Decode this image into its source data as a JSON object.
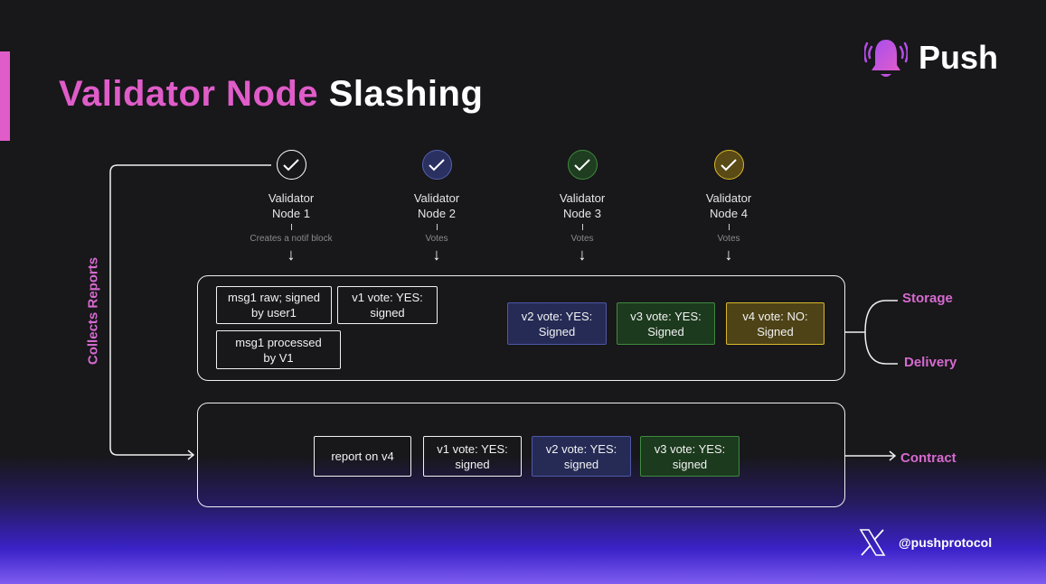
{
  "title": {
    "highlight": "Validator Node",
    "rest": "Slashing"
  },
  "brand": {
    "name": "Push",
    "icon": "bell-icon",
    "accent": "#e05cc9"
  },
  "side_label": "Collects Reports",
  "nodes": [
    {
      "line1": "Validator",
      "line2": "Node 1",
      "action": "Creates a notif block",
      "icon": "check-circle-icon",
      "color": "#ffffff"
    },
    {
      "line1": "Validator",
      "line2": "Node 2",
      "action": "Votes",
      "icon": "check-circle-icon",
      "color": "#5560b0"
    },
    {
      "line1": "Validator",
      "line2": "Node 3",
      "action": "Votes",
      "icon": "check-circle-icon",
      "color": "#3e8a3e"
    },
    {
      "line1": "Validator",
      "line2": "Node 4",
      "action": "Votes",
      "icon": "check-circle-icon",
      "color": "#d9b82a"
    }
  ],
  "block_panel": {
    "items": [
      {
        "line1": "msg1 raw; signed",
        "line2": "by user1",
        "style": "plain"
      },
      {
        "line1": "v1 vote: YES:",
        "line2": "signed",
        "style": "plain"
      },
      {
        "line1": "msg1 processed",
        "line2": "by V1",
        "style": "plain"
      },
      {
        "line1": "v2 vote: YES:",
        "line2": "Signed",
        "style": "blue"
      },
      {
        "line1": "v3 vote: YES:",
        "line2": "Signed",
        "style": "green"
      },
      {
        "line1": "v4 vote: NO:",
        "line2": "Signed",
        "style": "yellow"
      }
    ],
    "outputs": [
      "Storage",
      "Delivery"
    ]
  },
  "report_panel": {
    "items": [
      {
        "line1": "report on v4",
        "line2": "",
        "style": "plain"
      },
      {
        "line1": "v1 vote: YES:",
        "line2": "signed",
        "style": "plain"
      },
      {
        "line1": "v2 vote: YES:",
        "line2": "signed",
        "style": "blue"
      },
      {
        "line1": "v3 vote: YES:",
        "line2": "signed",
        "style": "green"
      }
    ],
    "output": "Contract"
  },
  "social": {
    "icon": "x-logo-icon",
    "handle": "@pushprotocol"
  }
}
